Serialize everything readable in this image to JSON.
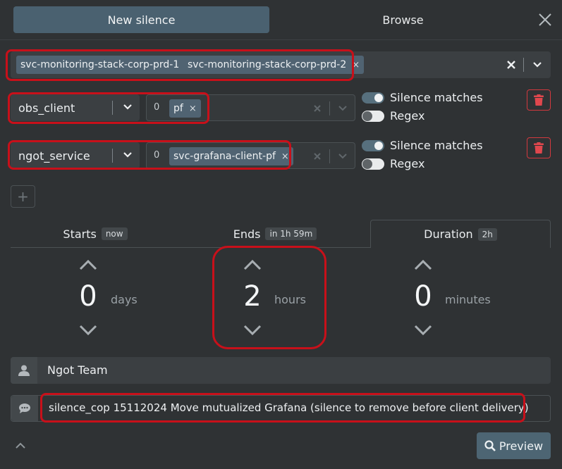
{
  "tabs": {
    "new_silence": "New silence",
    "browse": "Browse"
  },
  "instances": {
    "chips": [
      "svc-monitoring-stack-corp-prd-1",
      "svc-monitoring-stack-corp-prd-2"
    ],
    "remove_glyph": "×"
  },
  "matchers": [
    {
      "label": "obs_client",
      "count": "0",
      "values": [
        "pf"
      ],
      "toggle_matches": "Silence matches",
      "toggle_regex": "Regex",
      "silence_matches": true,
      "regex": false
    },
    {
      "label": "ngot_service",
      "count": "0",
      "values": [
        "svc-grafana-client-pf"
      ],
      "toggle_matches": "Silence matches",
      "toggle_regex": "Regex",
      "silence_matches": true,
      "regex": false
    }
  ],
  "add_glyph": "+",
  "time_tabs": [
    {
      "label": "Starts",
      "badge": "now"
    },
    {
      "label": "Ends",
      "badge": "in 1h 59m"
    },
    {
      "label": "Duration",
      "badge": "2h"
    }
  ],
  "duration": {
    "days": {
      "value": "0",
      "unit": "days"
    },
    "hours": {
      "value": "2",
      "unit": "hours"
    },
    "minutes": {
      "value": "0",
      "unit": "minutes"
    }
  },
  "author": {
    "value": "Ngot Team",
    "icon": "user-icon"
  },
  "comment": {
    "value": "silence_cop 15112024 Move mutualized Grafana (silence to remove before client delivery)",
    "icon": "comment-icon"
  },
  "preview_label": "Preview",
  "colors": {
    "accent": "#4a6170",
    "danger": "#d3393f",
    "highlight": "#c8101a"
  }
}
